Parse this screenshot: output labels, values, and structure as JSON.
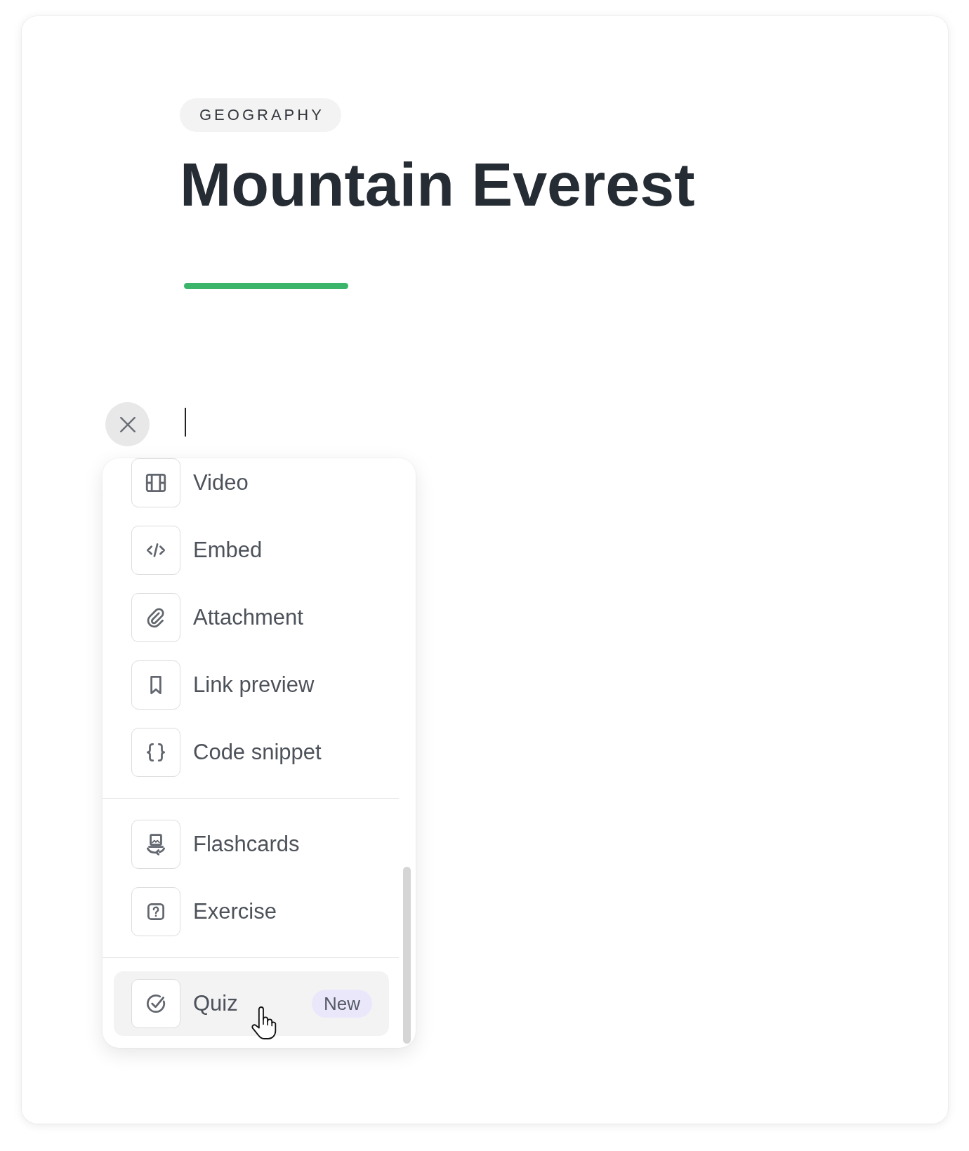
{
  "article": {
    "tag": "GEOGRAPHY",
    "title": "Mountain Everest"
  },
  "insert_menu": {
    "sections": [
      {
        "items": [
          {
            "kind": "video",
            "label": "Video",
            "highlighted": false
          },
          {
            "kind": "embed",
            "label": "Embed",
            "highlighted": false
          },
          {
            "kind": "attachment",
            "label": "Attachment",
            "highlighted": false
          },
          {
            "kind": "link",
            "label": "Link preview",
            "highlighted": false
          },
          {
            "kind": "code",
            "label": "Code snippet",
            "highlighted": false
          }
        ]
      },
      {
        "items": [
          {
            "kind": "flashcards",
            "label": "Flashcards",
            "highlighted": false
          },
          {
            "kind": "exercise",
            "label": "Exercise",
            "highlighted": false
          }
        ]
      },
      {
        "items": [
          {
            "kind": "quiz",
            "label": "Quiz",
            "highlighted": true,
            "badge": "New"
          }
        ]
      }
    ]
  }
}
